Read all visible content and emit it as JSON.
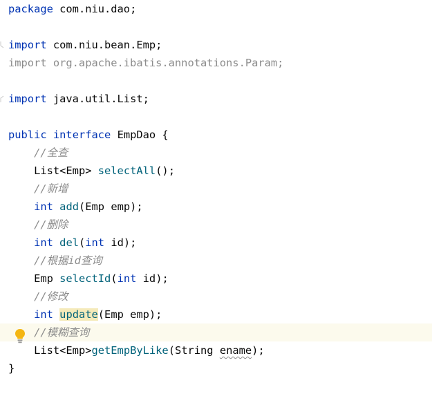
{
  "code": {
    "package_kw": "package",
    "package_name": " com.niu.dao;",
    "import_kw": "import",
    "import_emp": " com.niu.bean.Emp;",
    "import_param": "import org.apache.ibatis.annotations.Param;",
    "import_list": " java.util.List;",
    "public_kw": "public",
    "interface_kw": "interface",
    "class_decl": " EmpDao {",
    "comment_select_all": "//全查",
    "select_all_type": "List<Emp> ",
    "select_all_name": "selectAll",
    "select_all_sig": "();",
    "comment_add": "//新增",
    "int_kw": "int",
    "add_name": "add",
    "add_sig": "(Emp emp);",
    "comment_del": "//删除",
    "del_name": "del",
    "del_param_name": " id);",
    "comment_select_id": "//根据id查询",
    "select_id_type": "Emp ",
    "select_id_name": "selectId",
    "comment_update": "//修改",
    "update_name": "update",
    "update_sig": "(Emp emp);",
    "comment_like": "//模糊查询",
    "like_type": "List<Emp>",
    "like_name": "getEmpByLike",
    "like_sig_start": "(String ",
    "like_param": "ename",
    "like_sig_end": ");",
    "close_brace": "}"
  },
  "colors": {
    "keyword": "#0033b3",
    "comment": "#8c8c8c",
    "method": "#00627a",
    "text": "#080808",
    "caret_line": "#fcfaed",
    "usage_highlight": "#f5eaba",
    "bulb": "#f4b614"
  },
  "icons": {
    "fold": "fold-marker-icon",
    "intention": "lightbulb-icon"
  }
}
